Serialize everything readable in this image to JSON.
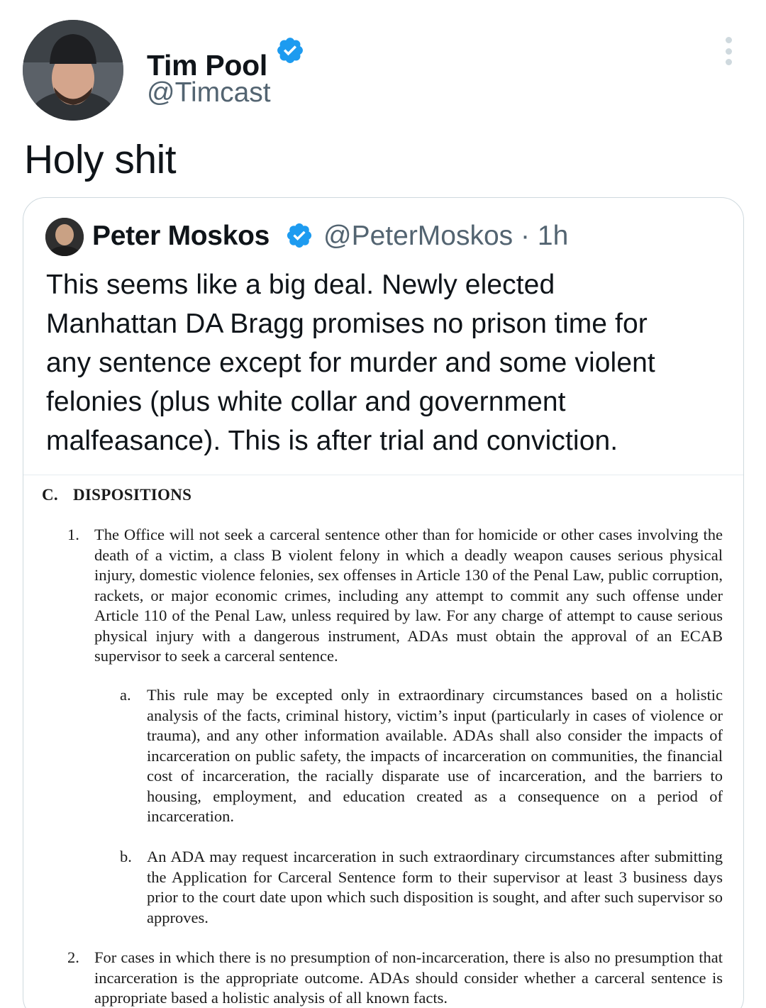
{
  "tweet": {
    "author": {
      "name": "Tim Pool",
      "handle": "@Timcast",
      "avatar_icon": "profile-photo-man-beanie"
    },
    "text": "Holy shit"
  },
  "quoted_tweet": {
    "author": {
      "name": "Peter Moskos",
      "handle": "@PeterMoskos",
      "separator": "·",
      "time": "1h",
      "avatar_icon": "profile-photo-man"
    },
    "text_lines": [
      "This seems like a big deal. Newly elected",
      "Manhattan DA Bragg promises no prison time for",
      "any sentence except for murder and some violent",
      "felonies (plus white collar and government",
      "malfeasance). This is after trial and conviction."
    ],
    "document": {
      "section_number": "C.",
      "section_title": "DISPOSITIONS",
      "items": [
        {
          "marker": "1.",
          "text": "The Office will not seek a carceral sentence other than for homicide or other cases involving the death of a victim, a class B violent felony in which a deadly weapon causes serious physical injury, domestic violence felonies, sex offenses in Article 130 of the Penal Law, public corruption, rackets, or major economic crimes, including any attempt to commit any such offense under Article 110 of the Penal Law, unless required by law. For any charge of attempt to cause serious physical injury with a dangerous instrument, ADAs must obtain the approval of an ECAB supervisor to seek a carceral sentence."
        },
        {
          "marker": "a.",
          "text": "This rule may be excepted only in extraordinary circumstances based on a holistic analysis of the facts, criminal history, victim’s input (particularly in cases of violence or trauma), and any other information available. ADAs shall also consider the impacts of incarceration on public safety, the impacts of incarceration on communities, the financial cost of incarceration, the racially disparate use of incarceration, and the barriers to housing, employment, and education created as a consequence on a period of incarceration."
        },
        {
          "marker": "b.",
          "text": "An ADA may request incarceration in such extraordinary circumstances after submitting the Application for Carceral Sentence form to their supervisor at least 3 business days prior to the court date upon which such disposition is sought, and after such supervisor so approves."
        },
        {
          "marker": "2.",
          "text": "For cases in which there is no presumption of non-incarceration, there is also no presumption that incarceration is the appropriate outcome. ADAs should consider whether a carceral sentence is appropriate based a holistic analysis of all known facts."
        }
      ]
    }
  },
  "colors": {
    "verified_blue": "#1d9bf0",
    "secondary_text": "#536471",
    "border": "#cfd9de"
  },
  "icons": {
    "verified": "verified-badge-icon",
    "more": "more-options-icon"
  }
}
